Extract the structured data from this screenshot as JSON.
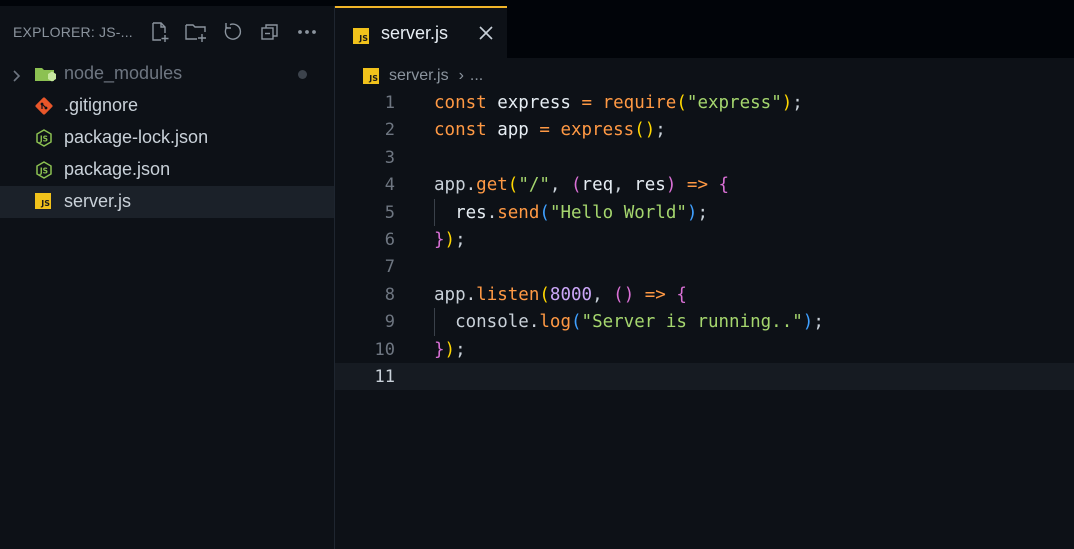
{
  "explorer": {
    "title": "EXPLORER: JS-...",
    "actions": [
      "new-file-icon",
      "new-folder-icon",
      "refresh-icon",
      "collapse-all-icon",
      "more-icon"
    ],
    "items": [
      {
        "label": "node_modules",
        "icon": "folder-icon",
        "chevron": true,
        "dim": true,
        "dot": true
      },
      {
        "label": ".gitignore",
        "icon": "git-icon"
      },
      {
        "label": "package-lock.json",
        "icon": "nodejs-icon"
      },
      {
        "label": "package.json",
        "icon": "nodejs-icon"
      },
      {
        "label": "server.js",
        "icon": "js-icon",
        "selected": true
      }
    ]
  },
  "tab": {
    "label": "server.js",
    "icon_text": "JS"
  },
  "breadcrumb": {
    "file": "server.js",
    "more": "..."
  },
  "colors": {
    "keyword": "#ff9944",
    "variable": "#e6edf3",
    "function": "#ff9944",
    "string": "#a5d66e",
    "paren1": "#ffd700",
    "paren2": "#da70d6",
    "paren3": "#3fa0ff",
    "number": "#cba6f7",
    "accent": "#f0b429"
  },
  "code_lines": [
    {
      "n": "1",
      "tokens": [
        [
          "const ",
          "kw"
        ],
        [
          "express",
          "var"
        ],
        [
          " = ",
          "op"
        ],
        [
          "require",
          "fn"
        ],
        [
          "(",
          "p1"
        ],
        [
          "\"express\"",
          "str"
        ],
        [
          ")",
          "p1"
        ],
        [
          ";",
          "pl"
        ]
      ]
    },
    {
      "n": "2",
      "tokens": [
        [
          "const ",
          "kw"
        ],
        [
          "app",
          "var"
        ],
        [
          " = ",
          "op"
        ],
        [
          "express",
          "fn"
        ],
        [
          "()",
          "p1"
        ],
        [
          ";",
          "pl"
        ]
      ]
    },
    {
      "n": "3",
      "tokens": []
    },
    {
      "n": "4",
      "tokens": [
        [
          "app",
          "pl"
        ],
        [
          ".",
          "pl"
        ],
        [
          "get",
          "fn"
        ],
        [
          "(",
          "p1"
        ],
        [
          "\"/\"",
          "str"
        ],
        [
          ", ",
          "pl"
        ],
        [
          "(",
          "p2"
        ],
        [
          "req",
          "var"
        ],
        [
          ", ",
          "pl"
        ],
        [
          "res",
          "var"
        ],
        [
          ")",
          "p2"
        ],
        [
          " => ",
          "kw"
        ],
        [
          "{",
          "p2"
        ]
      ]
    },
    {
      "n": "5",
      "indent": true,
      "tokens": [
        [
          "  res",
          "var"
        ],
        [
          ".",
          "pl"
        ],
        [
          "send",
          "fn"
        ],
        [
          "(",
          "p3"
        ],
        [
          "\"Hello World\"",
          "str"
        ],
        [
          ")",
          "p3"
        ],
        [
          ";",
          "pl"
        ]
      ]
    },
    {
      "n": "6",
      "tokens": [
        [
          "}",
          "p2"
        ],
        [
          ")",
          "p1"
        ],
        [
          ";",
          "pl"
        ]
      ]
    },
    {
      "n": "7",
      "tokens": []
    },
    {
      "n": "8",
      "tokens": [
        [
          "app",
          "pl"
        ],
        [
          ".",
          "pl"
        ],
        [
          "listen",
          "fn"
        ],
        [
          "(",
          "p1"
        ],
        [
          "8000",
          "num"
        ],
        [
          ", ",
          "pl"
        ],
        [
          "()",
          "p2"
        ],
        [
          " => ",
          "kw"
        ],
        [
          "{",
          "p2"
        ]
      ]
    },
    {
      "n": "9",
      "indent": true,
      "tokens": [
        [
          "  console",
          "pl"
        ],
        [
          ".",
          "pl"
        ],
        [
          "log",
          "fn"
        ],
        [
          "(",
          "p3"
        ],
        [
          "\"Server is running..\"",
          "str"
        ],
        [
          ")",
          "p3"
        ],
        [
          ";",
          "pl"
        ]
      ]
    },
    {
      "n": "10",
      "tokens": [
        [
          "}",
          "p2"
        ],
        [
          ")",
          "p1"
        ],
        [
          ";",
          "pl"
        ]
      ]
    },
    {
      "n": "11",
      "active": true,
      "tokens": []
    }
  ]
}
